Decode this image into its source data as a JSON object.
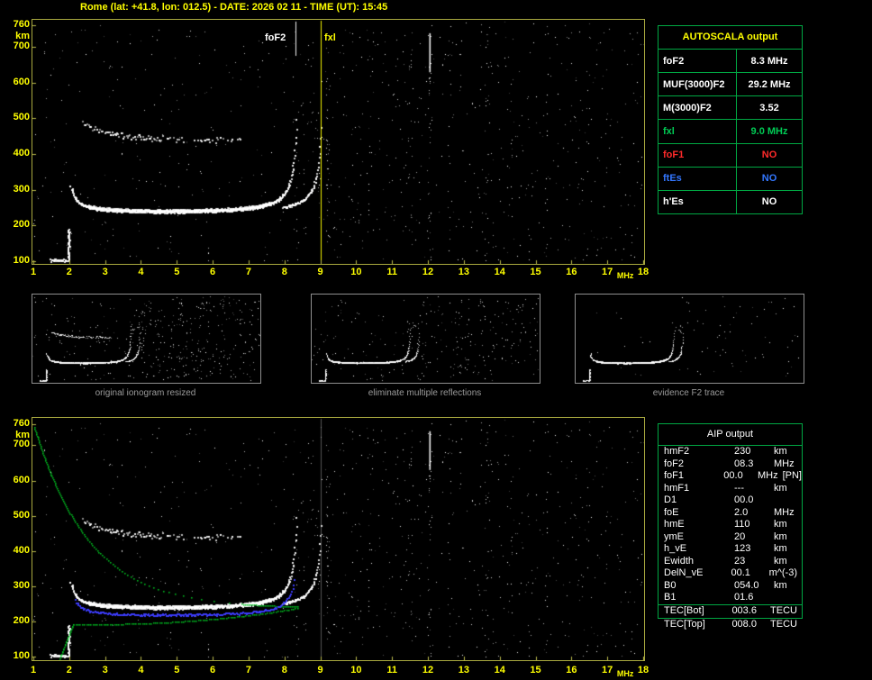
{
  "title": "Rome (lat: +41.8, lon: 012.5) - DATE: 2026 02 11 - TIME (UT): 15:45",
  "colors": {
    "background": "#000000",
    "axis_yellow": "#ffff00",
    "plot_border": "#a9a93f",
    "table_green": "#00a843",
    "caption_grey": "#9a9a9a",
    "fxi_green": "#00cc55",
    "fof1_red": "#ff2a2a",
    "ftes_blue": "#3377ff",
    "profile_green": "#00cc22",
    "restored_blue": "#3c3cff"
  },
  "autoscala_table": {
    "title": "AUTOSCALA output",
    "rows": [
      {
        "label": "foF2",
        "value": "8.3 MHz",
        "color": "#ffffff"
      },
      {
        "label": "MUF(3000)F2",
        "value": "29.2 MHz",
        "color": "#ffffff"
      },
      {
        "label": "M(3000)F2",
        "value": "3.52",
        "color": "#ffffff"
      },
      {
        "label": "fxl",
        "value": "9.0 MHz",
        "color": "#00cc55"
      },
      {
        "label": "foF1",
        "value": "NO",
        "color": "#ff2a2a"
      },
      {
        "label": "ftEs",
        "value": "NO",
        "color": "#3377ff"
      },
      {
        "label": "h'Es",
        "value": "NO",
        "color": "#ffffff"
      }
    ]
  },
  "thumbnails": [
    {
      "caption": "original ionogram resized"
    },
    {
      "caption": "eliminate multiple reflections"
    },
    {
      "caption": "evidence F2 trace"
    }
  ],
  "aip_table": {
    "title": "AIP output",
    "rows": [
      {
        "label": "hmF2",
        "value": "230",
        "unit": "km"
      },
      {
        "label": "foF2",
        "value": "08.3",
        "unit": "MHz"
      },
      {
        "label": "foF1",
        "value": "00.0",
        "unit": "MHz",
        "note": "[PN]"
      },
      {
        "label": "hmF1",
        "value": "---",
        "unit": "km"
      },
      {
        "label": "D1",
        "value": "00.0",
        "unit": ""
      },
      {
        "label": "foE",
        "value": "2.0",
        "unit": "MHz"
      },
      {
        "label": "hmE",
        "value": "110",
        "unit": "km"
      },
      {
        "label": "ymE",
        "value": "20",
        "unit": "km"
      },
      {
        "label": "h_vE",
        "value": "123",
        "unit": "km"
      },
      {
        "label": "Ewidth",
        "value": "23",
        "unit": "km"
      },
      {
        "label": "DelN_vE",
        "value": "00.1",
        "unit": "m^(-3)"
      },
      {
        "label": "B0",
        "value": "054.0",
        "unit": "km"
      },
      {
        "label": "B1",
        "value": "01.6",
        "unit": ""
      },
      {
        "label": "TEC[Bot]",
        "value": "003.6",
        "unit": "TECU"
      }
    ],
    "footer_row": {
      "label": "TEC[Top]",
      "value": "008.0",
      "unit": "TECU"
    }
  },
  "chart_data": {
    "type": "scatter",
    "description": "Ionosonde ionogram: virtual height (km) vs sounding frequency (MHz); top = scaled ionogram, bottom = ionogram with restored trace (blue) and electron density profile (green)",
    "axes": {
      "x_ticks": [
        1,
        2,
        3,
        4,
        5,
        6,
        7,
        8,
        9,
        10,
        11,
        12,
        13,
        14,
        15,
        16,
        17,
        18
      ],
      "x_unit": "MHz",
      "x_range": [
        1,
        18
      ],
      "y_ticks": [
        760,
        700,
        600,
        500,
        400,
        300,
        200,
        100
      ],
      "y_unit": "km",
      "y_range": [
        100,
        760
      ],
      "grid": false
    },
    "markers": [
      {
        "label": "foF2",
        "mhz": 8.3,
        "color": "#ffffff"
      },
      {
        "label": "fxl",
        "mhz": 9.0,
        "color": "#ffff00"
      }
    ],
    "f2_trace": {
      "h_base_km": 228,
      "o_asymptote_mhz": 8.42,
      "x_asymptote_mhz": 9.12,
      "flat_height_km": 240,
      "max_height_km": 505
    },
    "second_hop": {
      "f_range": [
        2.35,
        6.85
      ],
      "h_start_km": 486,
      "h_end_km": 440
    },
    "e_artifact": {
      "f_range": [
        1.45,
        2.05
      ],
      "h_range": [
        102,
        190
      ]
    },
    "profile_overlay": {
      "color": "#00cc22",
      "nose_mhz": 8.35,
      "nose_km": 238,
      "top_km": 753,
      "bottom_km": 95,
      "e_drop_mhz": 1.73
    },
    "restored_trace_overlay": {
      "color": "#3c3cff",
      "f_range": [
        2.15,
        8.3
      ],
      "base_km": 210,
      "max_km": 370
    },
    "noise": {
      "base_dots": 520,
      "right_dots": 240,
      "columns": [
        {
          "mhz": 12.05,
          "count": 40,
          "solid_segment": true
        },
        {
          "mhz": 9.2,
          "count": 30
        },
        {
          "mhz": 11.5,
          "count": 20
        },
        {
          "mhz": 13.65,
          "count": 16
        },
        {
          "mhz": 10.35,
          "count": 12
        },
        {
          "mhz": 15.3,
          "count": 10
        },
        {
          "mhz": 16.45,
          "count": 9
        },
        {
          "mhz": 12.6,
          "count": 12
        },
        {
          "mhz": 14.3,
          "count": 8
        }
      ]
    }
  }
}
